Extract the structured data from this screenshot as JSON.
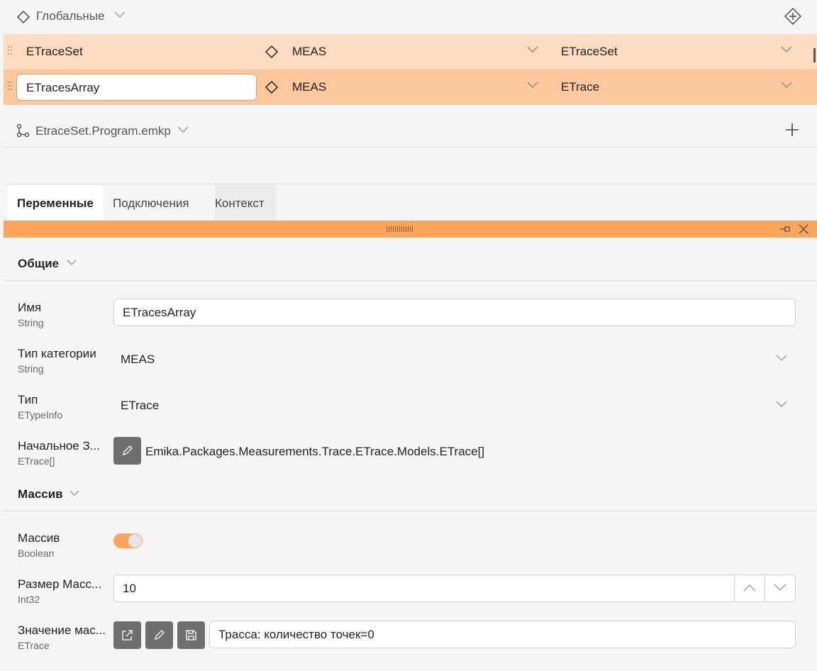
{
  "globals": {
    "label": "Глобальные"
  },
  "variables": [
    {
      "name": "ETraceSet",
      "category": "MEAS",
      "type": "ETraceSet"
    },
    {
      "name": "ETracesArray",
      "category": "MEAS",
      "type": "ETrace"
    }
  ],
  "program": {
    "label": "EtraceSet.Program.emkp"
  },
  "tabs": [
    {
      "label": "Переменные"
    },
    {
      "label": "Подключения"
    },
    {
      "label": "Контекст"
    }
  ],
  "sections": {
    "general": "Общие",
    "array": "Массив"
  },
  "props": {
    "name": {
      "label": "Имя",
      "type": "String",
      "value": "ETracesArray"
    },
    "category": {
      "label": "Тип категории",
      "type": "String",
      "value": "MEAS"
    },
    "type": {
      "label": "Тип",
      "type": "ETypeInfo",
      "value": "ETrace"
    },
    "initial": {
      "label": "Начальное З...",
      "type": "ETrace[]",
      "value": "Emika.Packages.Measurements.Trace.ETrace.Models.ETrace[]"
    },
    "is_array": {
      "label": "Массив",
      "type": "Boolean",
      "value": true
    },
    "array_size": {
      "label": "Размер Масс...",
      "type": "Int32",
      "value": "10"
    },
    "array_value": {
      "label": "Значение мас...",
      "type": "ETrace",
      "value": "Трасса: количество точек=0"
    }
  },
  "colors": {
    "accent": "#fba45c",
    "row1": "#fddbc0",
    "row2": "#fbc79d",
    "button": "#6e6e6e"
  }
}
